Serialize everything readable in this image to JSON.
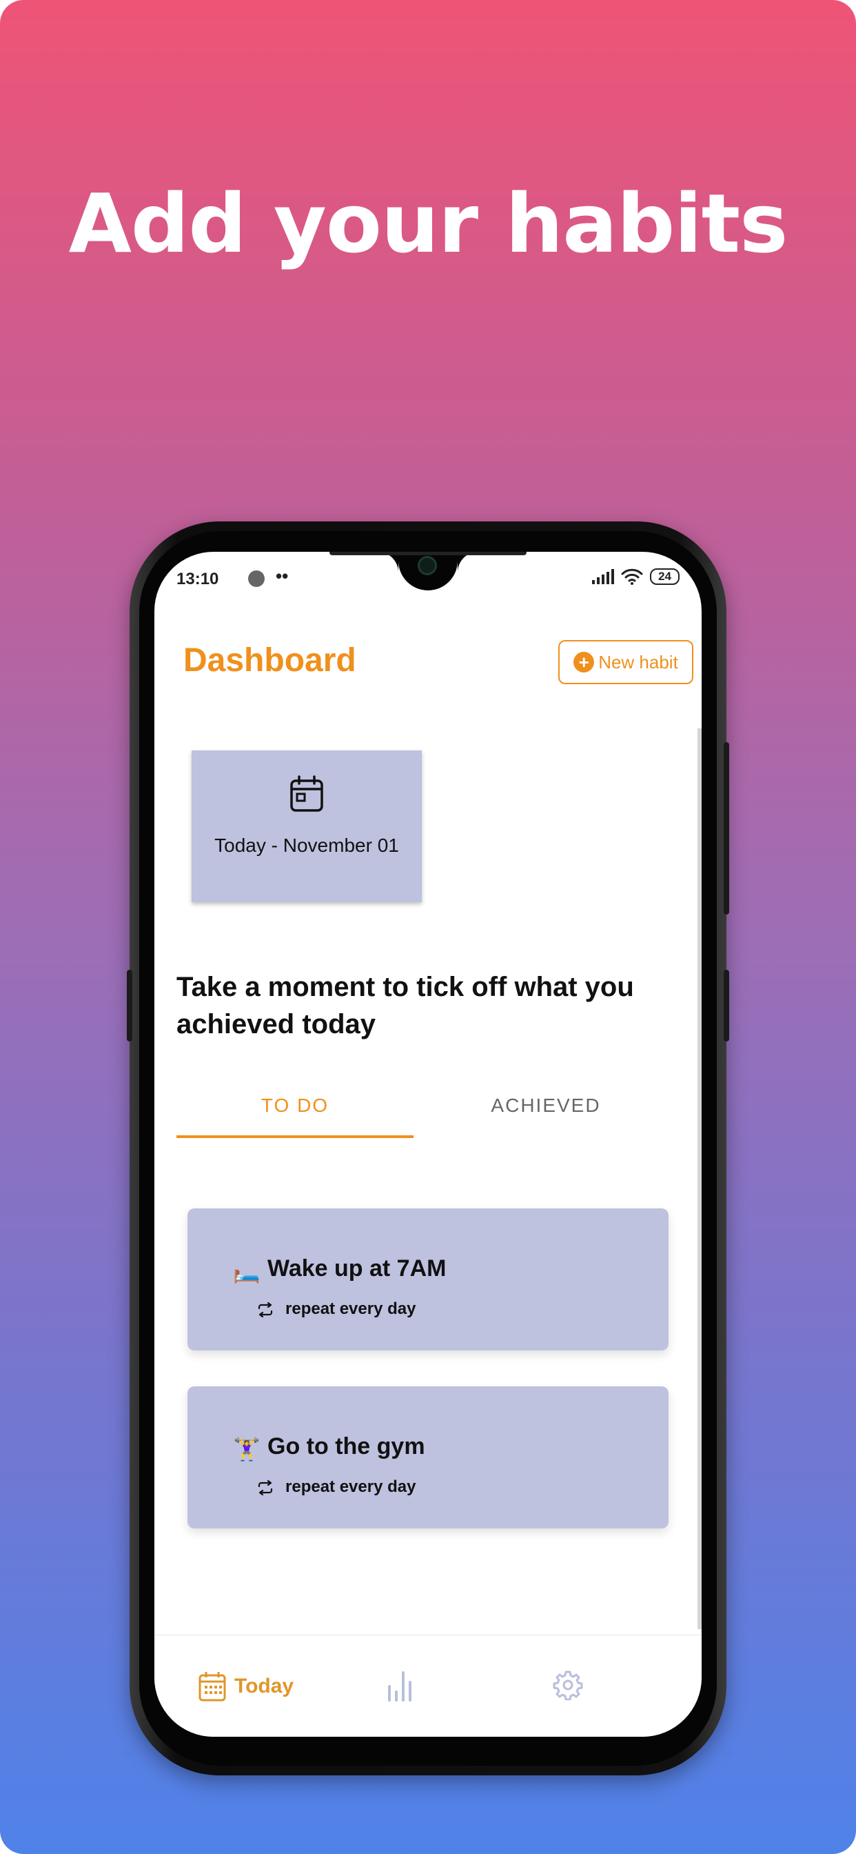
{
  "promo": {
    "headline": "Add your habits"
  },
  "status_bar": {
    "time": "13:10",
    "dots": "••",
    "battery": "24"
  },
  "header": {
    "title": "Dashboard",
    "new_habit_label": "New habit"
  },
  "date_card": {
    "label": "Today - November 01",
    "icon": "calendar-icon"
  },
  "prompt": "Take a moment to tick off what you achieved today",
  "tabs": [
    {
      "label": "TO DO",
      "active": true
    },
    {
      "label": "ACHIEVED",
      "active": false
    }
  ],
  "habits": [
    {
      "emoji": "🛏️",
      "name": "Wake up at 7AM",
      "repeat": "repeat every day"
    },
    {
      "emoji": "🏋️‍♀️",
      "name": "Go to the gym",
      "repeat": "repeat every day"
    }
  ],
  "bottom_nav": [
    {
      "label": "Today",
      "icon": "calendar-icon",
      "active": true
    },
    {
      "label": "",
      "icon": "bar-chart-icon",
      "active": false
    },
    {
      "label": "",
      "icon": "gear-icon",
      "active": false
    }
  ],
  "colors": {
    "accent": "#f0901c",
    "card": "#bec2df",
    "gradient_top": "#ee5476",
    "gradient_bottom": "#4f82e9"
  }
}
